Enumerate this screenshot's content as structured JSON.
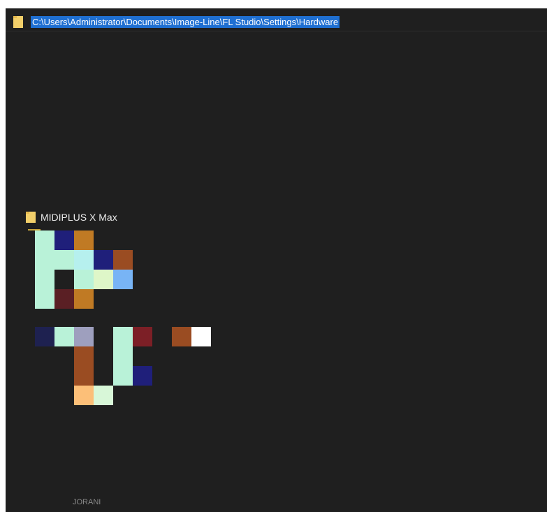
{
  "address_bar": {
    "path": "C:\\Users\\Administrator\\Documents\\Image-Line\\FL Studio\\Settings\\Hardware",
    "folder_icon": "folder-icon",
    "highlight_color": "#1f6fd1"
  },
  "folder": {
    "label": "MIDIPLUS X Max",
    "icon": "folder-icon",
    "icon_color": "#f2cf6a"
  },
  "preview_mosaic": {
    "colors": {
      "mint": "#b9f2d8",
      "navy": "#1f1f7a",
      "dark_navy": "#1e2150",
      "orange": "#c07a24",
      "rust": "#9a4c22",
      "light_cyan": "#b6f0ee",
      "pale_green": "#def6c8",
      "sky": "#78b4f5",
      "maroon": "#5a1f24",
      "lavender": "#9e9fbe",
      "deep_red": "#7c1f26",
      "white": "#ffffff",
      "peach": "#fcbf78",
      "pale_mint": "#d8f7d8"
    }
  },
  "footer": {
    "text": "JORANI"
  },
  "theme": {
    "background": "#1f1f1f",
    "text": "#e8e8e8"
  }
}
